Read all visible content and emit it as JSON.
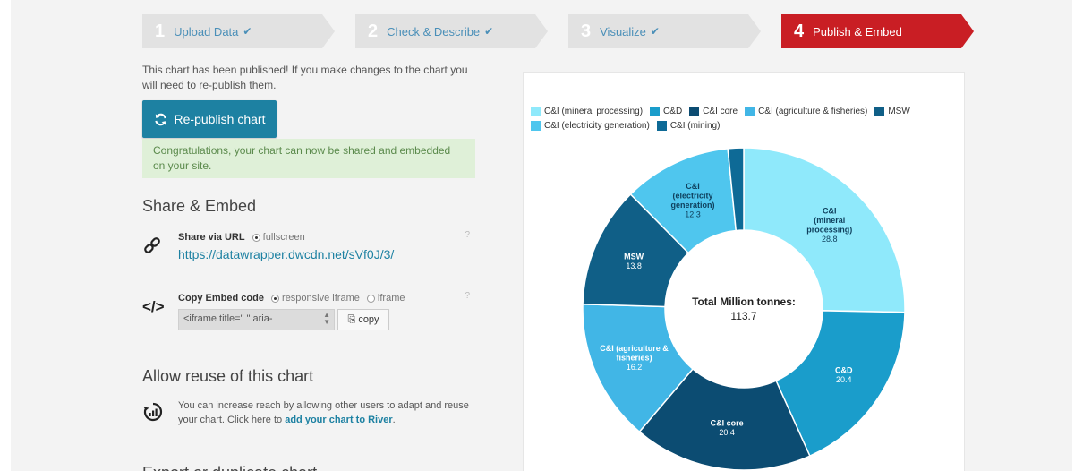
{
  "steps": [
    {
      "num": "1",
      "label": "Upload Data",
      "check": "✔"
    },
    {
      "num": "2",
      "label": "Check & Describe",
      "check": "✔"
    },
    {
      "num": "3",
      "label": "Visualize",
      "check": "✔"
    },
    {
      "num": "4",
      "label": "Publish & Embed",
      "check": ""
    }
  ],
  "publish": {
    "message": "This chart has been published! If you make changes to the chart you will need to re-publish them.",
    "republish_label": "Re-publish chart",
    "congrats": "Congratulations, your chart can now be shared and embedded on your site."
  },
  "share": {
    "title": "Share & Embed",
    "via_url_label": "Share via URL",
    "fullscreen_label": "fullscreen",
    "url": "https://datawrapper.dwcdn.net/sVf0J/3/",
    "help": "?"
  },
  "embed": {
    "label": "Copy Embed code",
    "responsive_label": "responsive iframe",
    "iframe_label": "iframe",
    "code_preview": "<iframe title=\"        \" aria-",
    "copy_label": "copy",
    "help": "?"
  },
  "reuse": {
    "title": "Allow reuse of this chart",
    "text": "You can increase reach by allowing other users to adapt and reuse your chart. Click here to ",
    "link": "add your chart to River",
    "suffix": ".",
    "cut_title": "Export or duplicate chart"
  },
  "chart_data": {
    "type": "pie",
    "donut": true,
    "center_label": "Total Million tonnes:",
    "center_value": "113.7",
    "legend_position": "top",
    "categories": [
      "C&I (mineral processing)",
      "C&D",
      "C&I core",
      "C&I (agriculture & fisheries)",
      "MSW",
      "C&I (electricity generation)",
      "C&I (mining)"
    ],
    "values": [
      28.8,
      20.4,
      20.4,
      16.2,
      13.8,
      12.3,
      1.8
    ],
    "slice_labels": [
      {
        "lines": [
          "C&I",
          "(mineral",
          "processing)"
        ],
        "value": "28.8"
      },
      {
        "lines": [
          "C&D"
        ],
        "value": "20.4"
      },
      {
        "lines": [
          "C&I core"
        ],
        "value": "20.4"
      },
      {
        "lines": [
          "C&I (agriculture &",
          "fisheries)"
        ],
        "value": "16.2"
      },
      {
        "lines": [
          "MSW"
        ],
        "value": "13.8"
      },
      {
        "lines": [
          "C&I",
          "(electricity",
          "generation)"
        ],
        "value": "12.3"
      },
      {
        "lines": [],
        "value": ""
      }
    ],
    "colors": [
      "#8fe9fb",
      "#1a9dcb",
      "#0c4c72",
      "#41b6e6",
      "#105f87",
      "#4fc6ee",
      "#0e6a96"
    ],
    "label_colors": [
      "#0e3f5c",
      "#ffffff",
      "#ffffff",
      "#ffffff",
      "#ffffff",
      "#0e3f5c",
      "#ffffff"
    ]
  }
}
